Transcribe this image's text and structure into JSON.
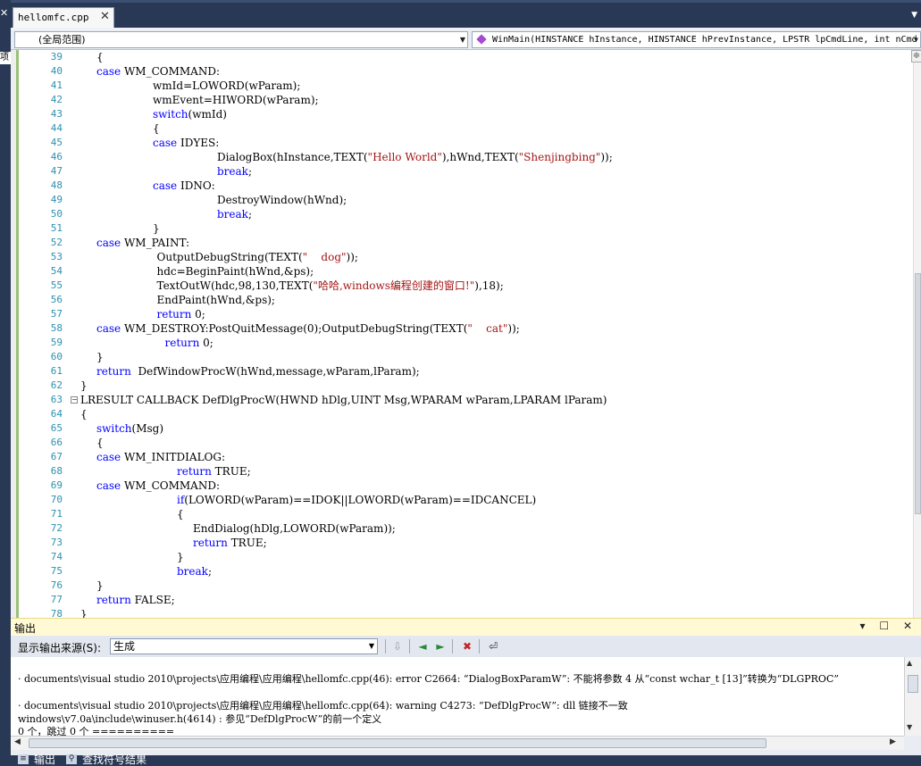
{
  "tab": {
    "filename": "hellomfc.cpp",
    "close": "✕"
  },
  "left_strip": {
    "close": "✕",
    "cut_label": "项目"
  },
  "nav": {
    "scope": "(全局范围)",
    "function": "WinMain(HINSTANCE hInstance, HINSTANCE hPrevInstance, LPSTR lpCmdLine, int nCmd"
  },
  "editor": {
    "lines": [
      {
        "n": "39",
        "indent": 2,
        "parts": [
          {
            "t": "{"
          }
        ]
      },
      {
        "n": "40",
        "indent": 2,
        "parts": [
          {
            "t": "case",
            "k": 1
          },
          {
            "t": " WM_COMMAND:"
          }
        ]
      },
      {
        "n": "41",
        "indent": 9,
        "parts": [
          {
            "t": "wmId=LOWORD(wParam);"
          }
        ]
      },
      {
        "n": "42",
        "indent": 9,
        "parts": [
          {
            "t": "wmEvent=HIWORD(wParam);"
          }
        ]
      },
      {
        "n": "43",
        "indent": 9,
        "parts": [
          {
            "t": "switch",
            "k": 1
          },
          {
            "t": "(wmId)"
          }
        ]
      },
      {
        "n": "44",
        "indent": 9,
        "parts": [
          {
            "t": "{"
          }
        ]
      },
      {
        "n": "45",
        "indent": 9,
        "parts": [
          {
            "t": "case",
            "k": 1
          },
          {
            "t": " IDYES:"
          }
        ]
      },
      {
        "n": "46",
        "indent": 17,
        "parts": [
          {
            "t": "DialogBox(hInstance,TEXT("
          },
          {
            "t": "\"Hello World\"",
            "s": 1
          },
          {
            "t": "),hWnd,TEXT("
          },
          {
            "t": "\"Shenjingbing\"",
            "s": 1
          },
          {
            "t": "));"
          }
        ]
      },
      {
        "n": "47",
        "indent": 17,
        "parts": [
          {
            "t": "break",
            "k": 1
          },
          {
            "t": ";"
          }
        ]
      },
      {
        "n": "48",
        "indent": 9,
        "parts": [
          {
            "t": "case",
            "k": 1
          },
          {
            "t": " IDNO:"
          }
        ]
      },
      {
        "n": "49",
        "indent": 17,
        "parts": [
          {
            "t": "DestroyWindow(hWnd);"
          }
        ]
      },
      {
        "n": "50",
        "indent": 17,
        "parts": [
          {
            "t": "break",
            "k": 1
          },
          {
            "t": ";"
          }
        ]
      },
      {
        "n": "51",
        "indent": 9,
        "parts": [
          {
            "t": "}"
          }
        ]
      },
      {
        "n": "52",
        "indent": 2,
        "parts": [
          {
            "t": "case",
            "k": 1
          },
          {
            "t": " WM_PAINT:"
          }
        ]
      },
      {
        "n": "53",
        "indent": 9.5,
        "parts": [
          {
            "t": "OutputDebugString(TEXT("
          },
          {
            "t": "\"    dog\"",
            "s": 1
          },
          {
            "t": "));"
          }
        ]
      },
      {
        "n": "54",
        "indent": 9.5,
        "parts": [
          {
            "t": "hdc=BeginPaint(hWnd,&ps);"
          }
        ]
      },
      {
        "n": "55",
        "indent": 9.5,
        "parts": [
          {
            "t": "TextOutW(hdc,98,130,TEXT("
          },
          {
            "t": "\"哈哈,windows编程创建的窗口!\"",
            "s": 1
          },
          {
            "t": "),18);"
          }
        ]
      },
      {
        "n": "56",
        "indent": 9.5,
        "parts": [
          {
            "t": "EndPaint(hWnd,&ps);"
          }
        ]
      },
      {
        "n": "57",
        "indent": 9.5,
        "parts": [
          {
            "t": "return",
            "k": 1
          },
          {
            "t": " 0;"
          }
        ]
      },
      {
        "n": "58",
        "indent": 2,
        "parts": [
          {
            "t": "case",
            "k": 1
          },
          {
            "t": " WM_DESTROY:PostQuitMessage(0);OutputDebugString(TEXT("
          },
          {
            "t": "\"    cat\"",
            "s": 1
          },
          {
            "t": "));"
          }
        ]
      },
      {
        "n": "59",
        "indent": 10.5,
        "parts": [
          {
            "t": "return",
            "k": 1
          },
          {
            "t": " 0;"
          }
        ]
      },
      {
        "n": "60",
        "indent": 2,
        "parts": [
          {
            "t": "}"
          }
        ]
      },
      {
        "n": "61",
        "indent": 2,
        "parts": [
          {
            "t": "return",
            "k": 1
          },
          {
            "t": "  DefWindowProcW(hWnd,message,wParam,lParam);"
          }
        ]
      },
      {
        "n": "62",
        "indent": 0,
        "parts": [
          {
            "t": "}"
          }
        ]
      },
      {
        "n": "63",
        "indent": 0,
        "fold": "−",
        "parts": [
          {
            "t": "LRESULT CALLBACK DefDlgProcW(HWND hDlg,UINT Msg,WPARAM wParam,LPARAM lParam)"
          }
        ]
      },
      {
        "n": "64",
        "indent": 0,
        "parts": [
          {
            "t": "{"
          }
        ]
      },
      {
        "n": "65",
        "indent": 2,
        "parts": [
          {
            "t": "switch",
            "k": 1
          },
          {
            "t": "(Msg)"
          }
        ]
      },
      {
        "n": "66",
        "indent": 2,
        "parts": [
          {
            "t": "{"
          }
        ]
      },
      {
        "n": "67",
        "indent": 2,
        "parts": [
          {
            "t": "case",
            "k": 1
          },
          {
            "t": " WM_INITDIALOG:"
          }
        ]
      },
      {
        "n": "68",
        "indent": 12,
        "parts": [
          {
            "t": "return",
            "k": 1
          },
          {
            "t": " TRUE;"
          }
        ]
      },
      {
        "n": "69",
        "indent": 2,
        "parts": [
          {
            "t": "case",
            "k": 1
          },
          {
            "t": " WM_COMMAND:"
          }
        ]
      },
      {
        "n": "70",
        "indent": 12,
        "parts": [
          {
            "t": "if",
            "k": 1
          },
          {
            "t": "(LOWORD(wParam)==IDOK||LOWORD(wParam)==IDCANCEL)"
          }
        ]
      },
      {
        "n": "71",
        "indent": 12,
        "parts": [
          {
            "t": "{"
          }
        ]
      },
      {
        "n": "72",
        "indent": 14,
        "parts": [
          {
            "t": "EndDialog(hDlg,LOWORD(wParam));"
          }
        ]
      },
      {
        "n": "73",
        "indent": 14,
        "parts": [
          {
            "t": "return",
            "k": 1
          },
          {
            "t": " TRUE;"
          }
        ]
      },
      {
        "n": "74",
        "indent": 12,
        "parts": [
          {
            "t": "}"
          }
        ]
      },
      {
        "n": "75",
        "indent": 12,
        "parts": [
          {
            "t": "break",
            "k": 1
          },
          {
            "t": ";"
          }
        ]
      },
      {
        "n": "76",
        "indent": 2,
        "parts": [
          {
            "t": "}"
          }
        ]
      },
      {
        "n": "77",
        "indent": 2,
        "parts": [
          {
            "t": "return",
            "k": 1
          },
          {
            "t": " FALSE;"
          }
        ]
      },
      {
        "n": "78",
        "indent": 0,
        "parts": [
          {
            "t": "}"
          }
        ]
      }
    ]
  },
  "output": {
    "title": "输出",
    "window_controls": "▾ ☐ ✕",
    "source_label": "显示输出来源(S):",
    "source_value": "生成",
    "lines": [
      "",
      "· documents\\visual studio 2010\\projects\\应用编程\\应用编程\\hellomfc.cpp(46): error C2664: “DialogBoxParamW”: 不能将参数 4 从“const wchar_t [13]”转换为“DLGPROC”",
      "",
      "· documents\\visual studio 2010\\projects\\应用编程\\应用编程\\hellomfc.cpp(64): warning C4273: “DefDlgProcW”: dll 链接不一致",
      "windows\\v7.0a\\include\\winuser.h(4614) : 参见“DefDlgProcW”的前一个定义",
      "0 个，跳过 0 个 =========="
    ]
  },
  "bottom_tabs": [
    {
      "label": "输出",
      "icon": "output-icon"
    },
    {
      "label": "查找符号结果",
      "icon": "find-symbol-icon"
    }
  ],
  "colors": {
    "keyword": "#0000ff",
    "string": "#a31515",
    "line_number": "#2b91af",
    "chrome": "#293955"
  }
}
